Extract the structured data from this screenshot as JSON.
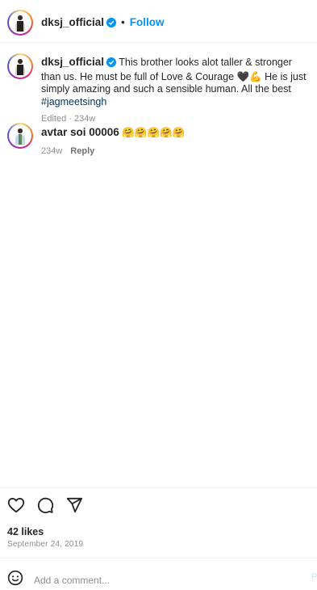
{
  "header": {
    "username": "dksj_official",
    "separator": "•",
    "follow_label": "Follow"
  },
  "caption": {
    "username": "dksj_official",
    "text_before_heart": "This brother looks alot taller & stronger than us. He must be full of Love & Courage",
    "text_after_emoji": "He is just simply amazing and such a sensible human. All the best",
    "hashtag": "#jagmeetsingh",
    "meta": "Edited · 234w"
  },
  "comment": {
    "username": "avtar soi 00006",
    "emojis": "🤗🤗🤗🤗🤗",
    "age": "234w",
    "reply_label": "Reply"
  },
  "footer": {
    "likes": "42 likes",
    "date": "September 24, 2019",
    "comment_placeholder": "Add a comment...",
    "post_label": "P"
  },
  "icons": {
    "header_avatar": "profile-avatar-icon",
    "verified": "verified-badge-icon",
    "like": "heart-icon",
    "comment": "comment-icon",
    "share": "share-icon",
    "emoji": "smiley-icon"
  },
  "colors": {
    "link": "#0095f6",
    "hashtag": "#00376b",
    "muted": "#8e8e8e",
    "text": "#262626"
  }
}
